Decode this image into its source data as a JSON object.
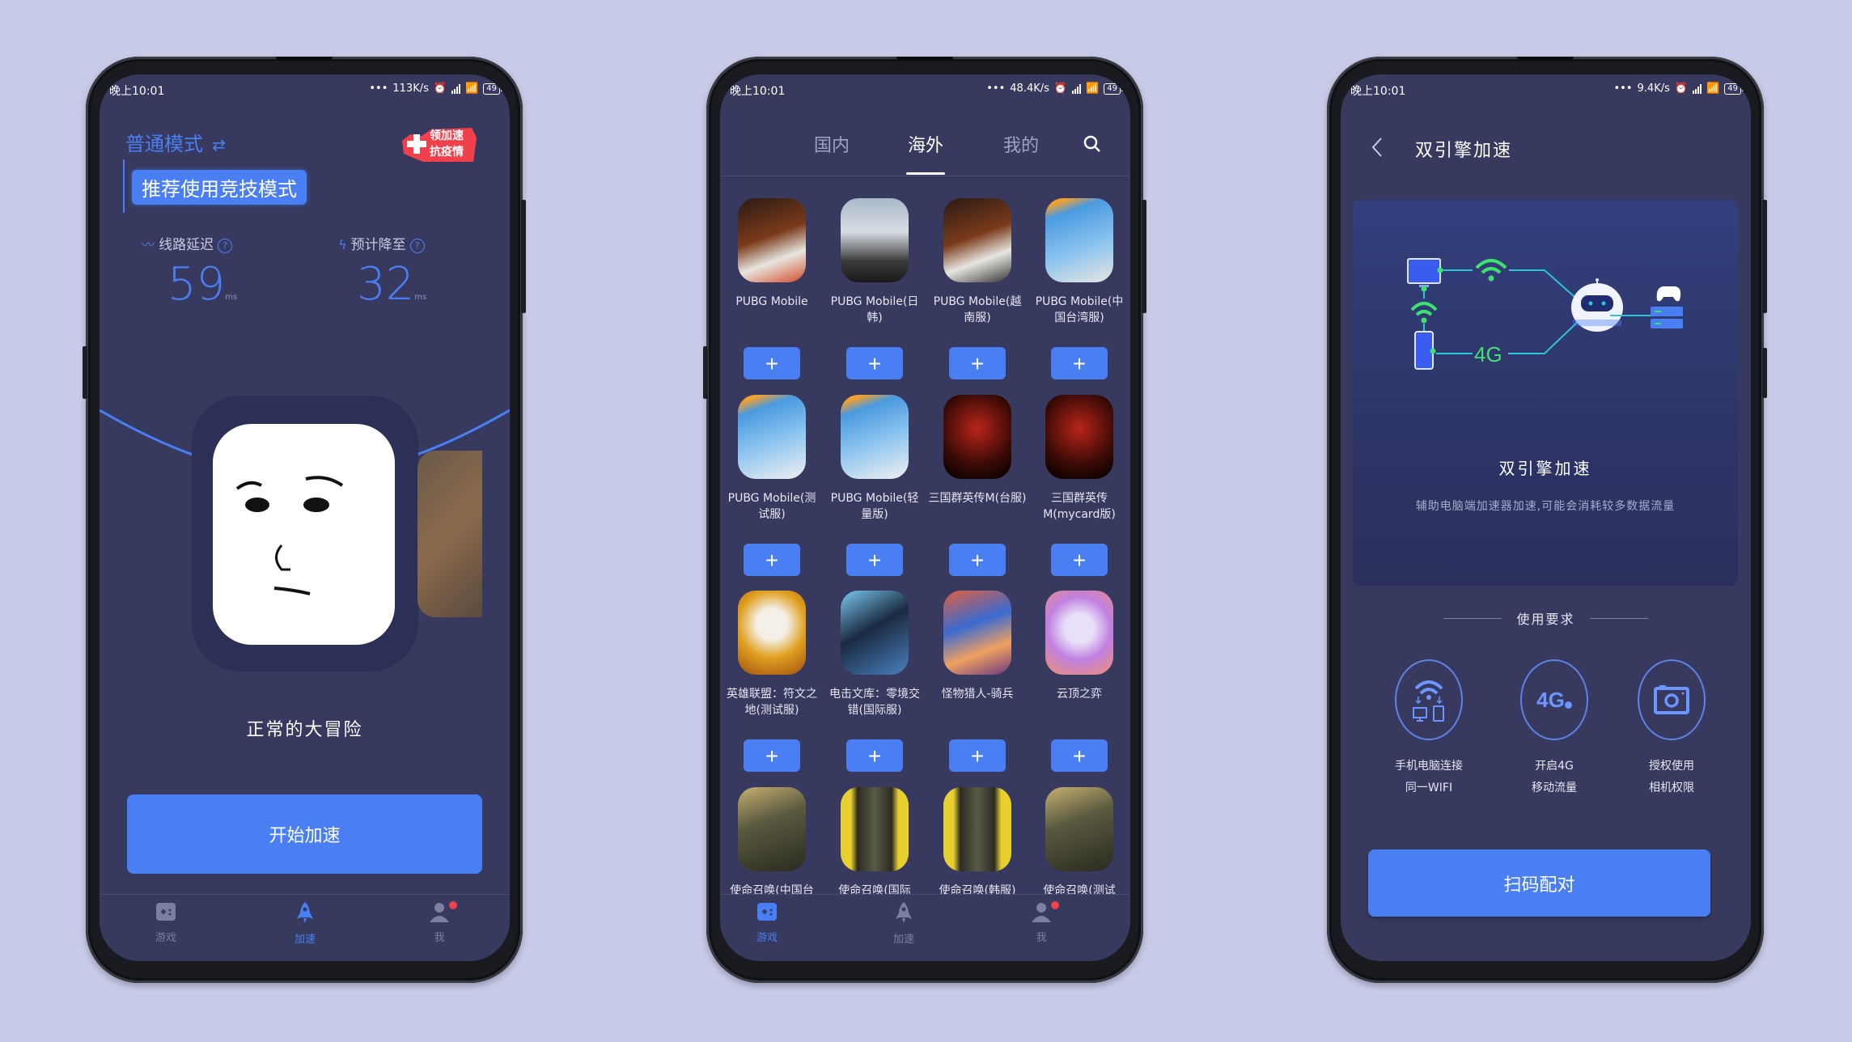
{
  "colors": {
    "background": "#c8cbe8",
    "screen": "#373a5e",
    "accent": "#4a7ff4",
    "badge_red": "#f0404c",
    "diagram_green": "#3ee26c",
    "diagram_line": "#2bc4d8"
  },
  "phones": [
    {
      "status": {
        "time": "晚上10:01",
        "speed": "113K/s",
        "battery": "49"
      },
      "mode": {
        "title": "普通模式",
        "switch_icon": "swap-icon",
        "recommend": "推荐使用竞技模式"
      },
      "promo_badge": {
        "line1": "领加速",
        "line2": "抗疫情"
      },
      "stats": [
        {
          "label": "线路延迟",
          "icon": "wave-icon",
          "value": "59",
          "unit": "ms"
        },
        {
          "label": "预计降至",
          "icon": "lightning-icon",
          "value": "32",
          "unit": "ms"
        }
      ],
      "selected_game": {
        "name": "正常的大冒险"
      },
      "start_button": "开始加速",
      "nav": [
        {
          "label": "游戏",
          "icon": "gamepad-icon",
          "active": false
        },
        {
          "label": "加速",
          "icon": "rocket-icon",
          "active": true
        },
        {
          "label": "我",
          "icon": "user-icon",
          "active": false,
          "badge": true
        }
      ]
    },
    {
      "status": {
        "time": "晚上10:01",
        "speed": "48.4K/s",
        "battery": "49"
      },
      "tabs": [
        {
          "label": "国内",
          "active": false
        },
        {
          "label": "海外",
          "active": true
        },
        {
          "label": "我的",
          "active": false
        }
      ],
      "games": [
        {
          "name": "PUBG Mobile",
          "art": "pubg"
        },
        {
          "name": "PUBG Mobile(日韩)",
          "art": "pubg-bg"
        },
        {
          "name": "PUBG Mobile(越南服)",
          "art": "pubg-vng"
        },
        {
          "name": "PUBG Mobile(中国台湾服)",
          "art": "pubg-tw"
        },
        {
          "name": "PUBG Mobile(测试服)",
          "art": "pubg-test"
        },
        {
          "name": "PUBG Mobile(轻量版)",
          "art": "pubg-lite"
        },
        {
          "name": "三国群英传M(台服)",
          "art": "sanguo"
        },
        {
          "name": "三国群英传M(mycard版)",
          "art": "sanguo"
        },
        {
          "name": "英雄联盟：符文之地(测试服)",
          "art": "lol"
        },
        {
          "name": "电击文库：零境交错(国际服)",
          "art": "dengeki"
        },
        {
          "name": "怪物猎人-骑兵",
          "art": "mh"
        },
        {
          "name": "云顶之弈",
          "art": "tft"
        },
        {
          "name": "使命召唤(中国台",
          "art": "cod-garena"
        },
        {
          "name": "使命召唤(国际",
          "art": "cod"
        },
        {
          "name": "使命召唤(韩服)",
          "art": "cod"
        },
        {
          "name": "使命召唤(测试",
          "art": "cod-garena"
        }
      ],
      "add_label": "+",
      "nav": [
        {
          "label": "游戏",
          "icon": "gamepad-icon",
          "active": true
        },
        {
          "label": "加速",
          "icon": "rocket-icon",
          "active": false
        },
        {
          "label": "我",
          "icon": "user-icon",
          "active": false,
          "badge": true
        }
      ]
    },
    {
      "status": {
        "time": "晚上10:01",
        "speed": "9.4K/s",
        "battery": "49"
      },
      "header": {
        "title": "双引擎加速"
      },
      "diagram": {
        "label_4g": "4G"
      },
      "feature": {
        "title": "双引擎加速",
        "description": "辅助电脑端加速器加速,可能会消耗较多数据流量"
      },
      "requirements": {
        "title": "使用要求",
        "items": [
          {
            "icon": "wifi-devices-icon",
            "line1": "手机电脑连接",
            "line2": "同一WIFI"
          },
          {
            "icon": "4g-icon",
            "line1": "开启4G",
            "line2": "移动流量",
            "glyph": "4G"
          },
          {
            "icon": "camera-icon",
            "line1": "授权使用",
            "line2": "相机权限"
          }
        ]
      },
      "scan_button": "扫码配对"
    }
  ]
}
